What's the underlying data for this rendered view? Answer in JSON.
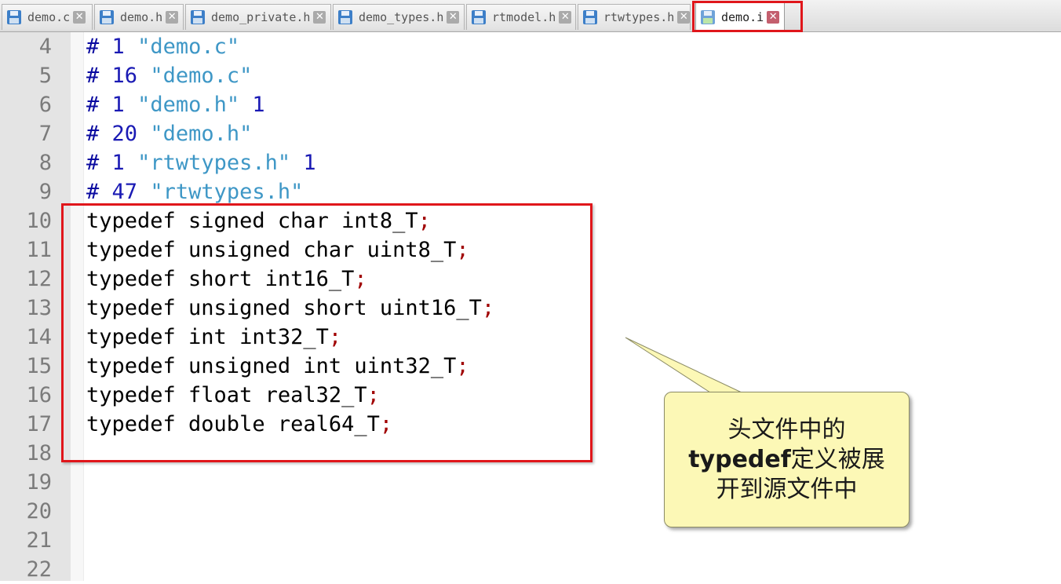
{
  "tabs": [
    {
      "label": "demo.c",
      "active": false
    },
    {
      "label": "demo.h",
      "active": false
    },
    {
      "label": "demo_private.h",
      "active": false
    },
    {
      "label": "demo_types.h",
      "active": false
    },
    {
      "label": "rtmodel.h",
      "active": false
    },
    {
      "label": "rtwtypes.h",
      "active": false
    },
    {
      "label": "demo.i",
      "active": true
    }
  ],
  "close_glyph": "✕",
  "editor": {
    "lines": [
      {
        "n": "4",
        "parts": [
          [
            "dir",
            "#"
          ],
          [
            "p",
            " "
          ],
          [
            "num",
            "1"
          ],
          [
            "p",
            " "
          ],
          [
            "str",
            "\"demo.c\""
          ]
        ]
      },
      {
        "n": "5",
        "parts": [
          [
            "dir",
            "#"
          ],
          [
            "p",
            " "
          ],
          [
            "num",
            "16"
          ],
          [
            "p",
            " "
          ],
          [
            "str",
            "\"demo.c\""
          ]
        ]
      },
      {
        "n": "6",
        "parts": [
          [
            "dir",
            "#"
          ],
          [
            "p",
            " "
          ],
          [
            "num",
            "1"
          ],
          [
            "p",
            " "
          ],
          [
            "str",
            "\"demo.h\""
          ],
          [
            "p",
            " "
          ],
          [
            "num",
            "1"
          ]
        ]
      },
      {
        "n": "7",
        "parts": [
          [
            "dir",
            "#"
          ],
          [
            "p",
            " "
          ],
          [
            "num",
            "20"
          ],
          [
            "p",
            " "
          ],
          [
            "str",
            "\"demo.h\""
          ]
        ]
      },
      {
        "n": "8",
        "parts": [
          [
            "dir",
            "#"
          ],
          [
            "p",
            " "
          ],
          [
            "num",
            "1"
          ],
          [
            "p",
            " "
          ],
          [
            "str",
            "\"rtwtypes.h\""
          ],
          [
            "p",
            " "
          ],
          [
            "num",
            "1"
          ]
        ]
      },
      {
        "n": "9",
        "parts": [
          [
            "dir",
            "#"
          ],
          [
            "p",
            " "
          ],
          [
            "num",
            "47"
          ],
          [
            "p",
            " "
          ],
          [
            "str",
            "\"rtwtypes.h\""
          ]
        ]
      },
      {
        "n": "10",
        "parts": [
          [
            "p",
            "typedef signed char int8_T"
          ],
          [
            "semi",
            ";"
          ]
        ]
      },
      {
        "n": "11",
        "parts": [
          [
            "p",
            "typedef unsigned char uint8_T"
          ],
          [
            "semi",
            ";"
          ]
        ]
      },
      {
        "n": "12",
        "parts": [
          [
            "p",
            "typedef short int16_T"
          ],
          [
            "semi",
            ";"
          ]
        ]
      },
      {
        "n": "13",
        "parts": [
          [
            "p",
            "typedef unsigned short uint16_T"
          ],
          [
            "semi",
            ";"
          ]
        ]
      },
      {
        "n": "14",
        "parts": [
          [
            "p",
            "typedef int int32_T"
          ],
          [
            "semi",
            ";"
          ]
        ]
      },
      {
        "n": "15",
        "parts": [
          [
            "p",
            "typedef unsigned int uint32_T"
          ],
          [
            "semi",
            ";"
          ]
        ]
      },
      {
        "n": "16",
        "parts": [
          [
            "p",
            "typedef float real32_T"
          ],
          [
            "semi",
            ";"
          ]
        ]
      },
      {
        "n": "17",
        "parts": [
          [
            "p",
            "typedef double real64_T"
          ],
          [
            "semi",
            ";"
          ]
        ]
      },
      {
        "n": "18",
        "parts": []
      },
      {
        "n": "19",
        "parts": []
      },
      {
        "n": "20",
        "parts": []
      },
      {
        "n": "21",
        "parts": []
      },
      {
        "n": "22",
        "parts": []
      }
    ]
  },
  "callout": {
    "line1": "头文件中的",
    "line2_bold": "typedef",
    "line2_rest": "定义被展",
    "line3": "开到源文件中"
  },
  "colors": {
    "highlight_border": "#e0161b",
    "callout_fill": "#fcf8b6",
    "directive": "#0a0aa0",
    "string": "#3e97c6",
    "semicolon": "#a00000"
  }
}
